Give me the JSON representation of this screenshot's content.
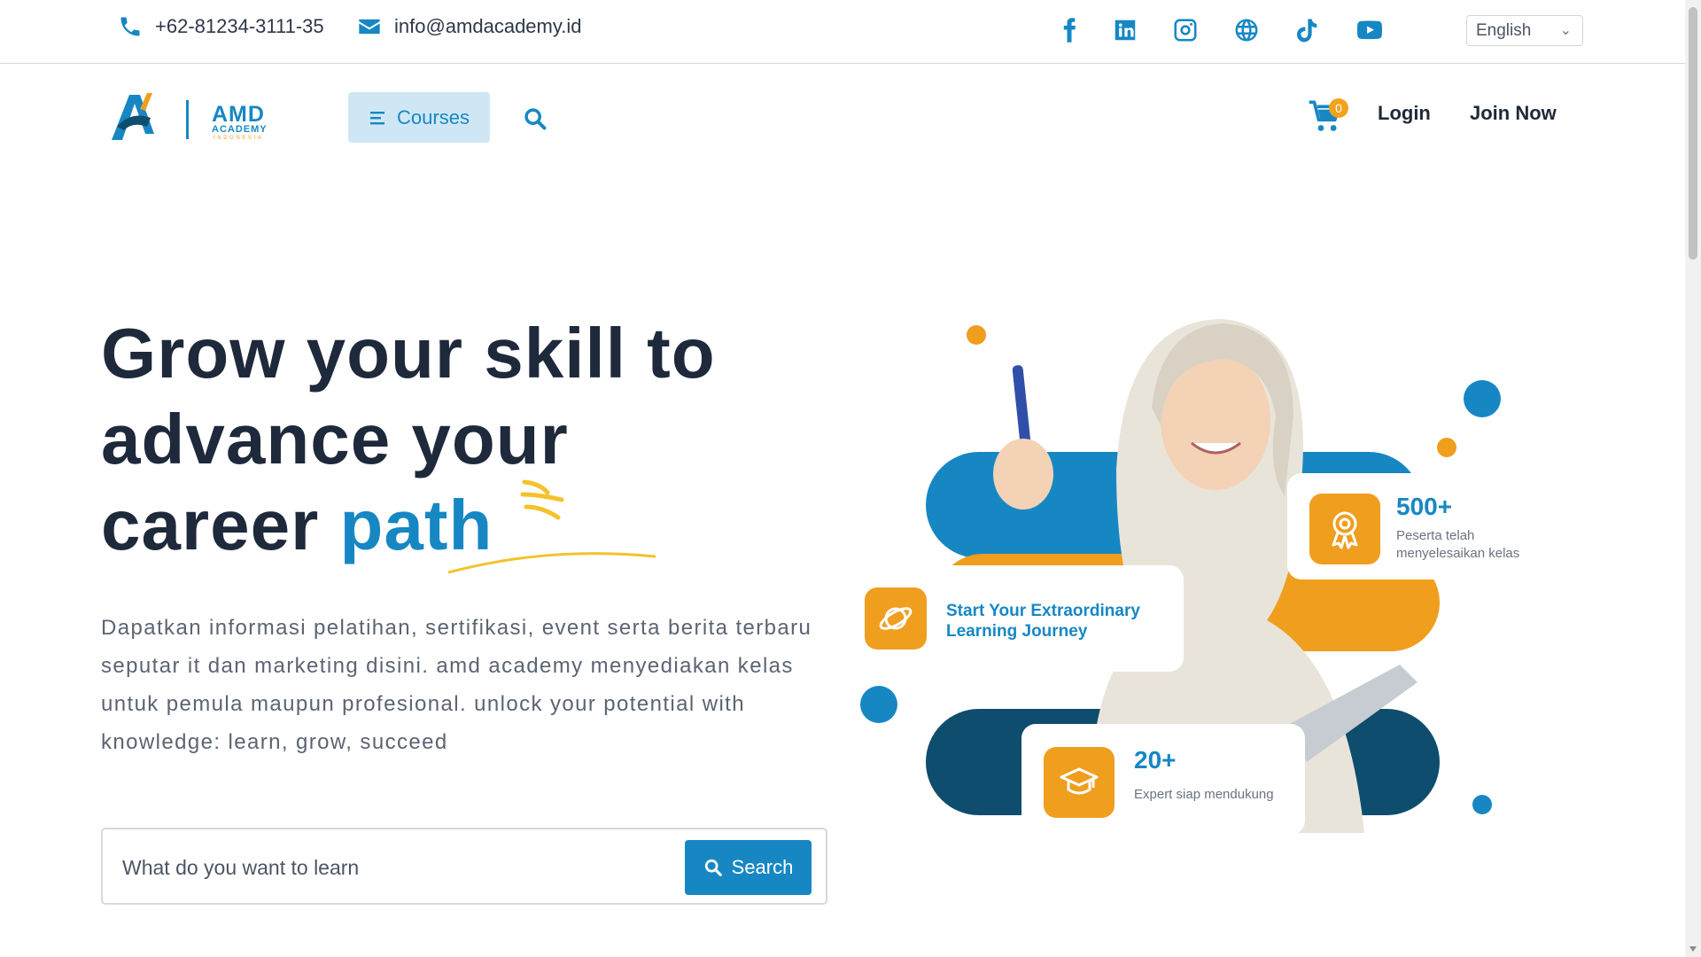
{
  "topbar": {
    "phone": "+62-81234-3111-35",
    "email": "info@amdacademy.id",
    "socials": [
      "facebook-icon",
      "linkedin-icon",
      "instagram-icon",
      "globe-icon",
      "tiktok-icon",
      "youtube-icon"
    ],
    "language": "English"
  },
  "nav": {
    "logo_text": "AMD",
    "logo_sub": "ACADEMY",
    "logo_sub2": "INDONESIA",
    "courses_label": "Courses",
    "cart_count": "0",
    "login_label": "Login",
    "join_label": "Join Now"
  },
  "hero": {
    "title_line1": "Grow your skill to",
    "title_line2": "advance your",
    "title_line3a": "career ",
    "title_highlight": "path",
    "description": "Dapatkan informasi pelatihan, sertifikasi, event serta berita terbaru seputar it dan marketing disini. amd academy menyediakan kelas untuk pemula maupun profesional. unlock your potential with knowledge: learn, grow, succeed",
    "search_placeholder": "What do you want to learn",
    "search_button": "Search"
  },
  "illustration": {
    "journey_line1": "Start Your Extraordinary",
    "journey_line2": "Learning Journey",
    "stat1_num": "500+",
    "stat1_label1": "Peserta telah",
    "stat1_label2": "menyelesaikan kelas",
    "stat2_num": "20+",
    "stat2_label": "Expert siap mendukung"
  },
  "colors": {
    "primary": "#1787c4",
    "accent": "#ef9e1e",
    "dark": "#1e293b",
    "navy": "#0e4d6e"
  }
}
